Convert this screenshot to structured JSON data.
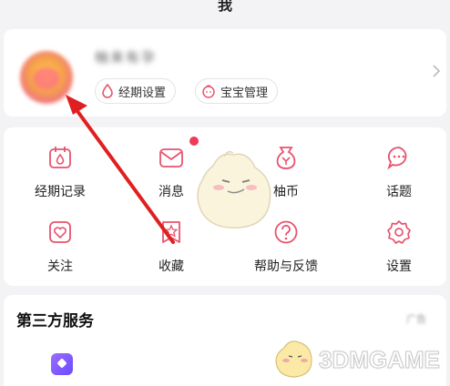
{
  "header": {
    "title": "我"
  },
  "profile": {
    "nickname": "柚来有孕",
    "chips": [
      {
        "label": "经期设置",
        "icon": "drop-icon"
      },
      {
        "label": "宝宝管理",
        "icon": "baby-face-icon"
      }
    ]
  },
  "grid": {
    "items": [
      {
        "label": "经期记录",
        "icon": "calendar-drop-icon",
        "badge": false
      },
      {
        "label": "消息",
        "icon": "mail-icon",
        "badge": true
      },
      {
        "label": "柚币",
        "icon": "pouch-icon",
        "badge": false
      },
      {
        "label": "话题",
        "icon": "chat-bubble-icon",
        "badge": false
      },
      {
        "label": "关注",
        "icon": "heart-icon",
        "badge": false
      },
      {
        "label": "收藏",
        "icon": "star-bookmark-icon",
        "badge": false
      },
      {
        "label": "帮助与反馈",
        "icon": "help-icon",
        "badge": false
      },
      {
        "label": "设置",
        "icon": "gear-icon",
        "badge": false
      }
    ]
  },
  "third_party": {
    "title": "第三方服务",
    "ad_tag": "广告",
    "services": [
      {
        "icon": "purple-service-icon"
      }
    ]
  },
  "watermark": {
    "text": "3DMGAME"
  },
  "colors": {
    "accent": "#e8536e",
    "badge": "#ee3b57",
    "arrow": "#e02020"
  }
}
